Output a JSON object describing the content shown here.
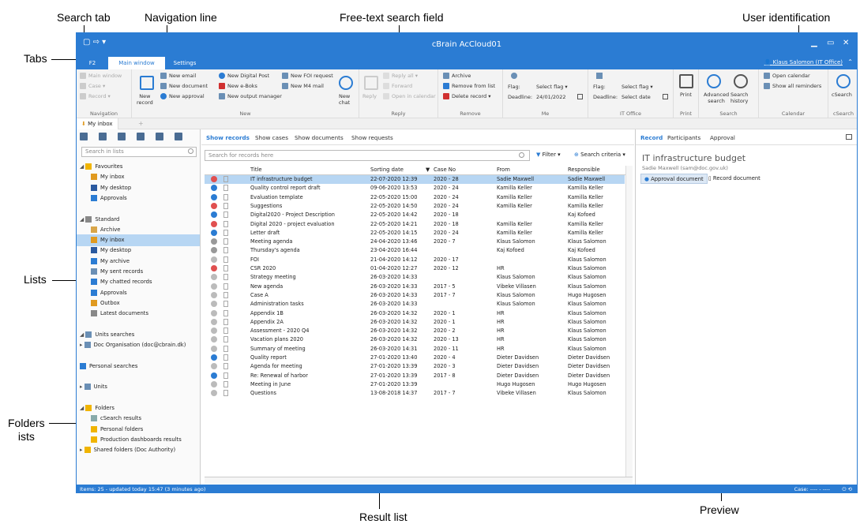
{
  "callouts": {
    "search_tab": "Search tab",
    "navigation_line": "Navigation line",
    "free_text": "Free-text search field",
    "user_id": "User identification",
    "tabs": "Tabs",
    "lists": "Lists",
    "folders": "Folders\nists",
    "result_list": "Result list",
    "preview": "Preview"
  },
  "app": {
    "title": "cBrain AcCloud01",
    "user": "Klaus Salomon (IT Office)"
  },
  "tabs": [
    "F2",
    "Main window",
    "Settings"
  ],
  "ribbon": {
    "nav": {
      "label": "Navigation",
      "items": [
        "Main window",
        "Case",
        "Record"
      ]
    },
    "new": {
      "label": "New",
      "big": "New\nrecord",
      "items": [
        "New email",
        "New document",
        "New approval",
        "New Digital Post",
        "New e-Boks",
        "New output manager",
        "New FOI request",
        "New M4 mail"
      ],
      "chat": "New\nchat"
    },
    "reply": {
      "label": "Reply",
      "big": "Reply",
      "items": [
        "Reply all",
        "Forward",
        "Open in calendar"
      ]
    },
    "remove": {
      "label": "Remove",
      "items": [
        "Archive",
        "Remove from list",
        "Delete record"
      ]
    },
    "me": {
      "label": "Me",
      "flag": "Flag:",
      "flagval": "Select flag",
      "deadline": "Deadline:",
      "deadlineval": "24/01/2022"
    },
    "itoffice": {
      "label": "IT Office",
      "flag": "Flag:",
      "flagval": "Select flag",
      "deadline": "Deadline:",
      "deadlineval": "Select date"
    },
    "print": {
      "label": "Print",
      "big": "Print"
    },
    "search": {
      "label": "Search",
      "adv": "Advanced\nsearch",
      "hist": "Search\nhistory"
    },
    "calendar": {
      "label": "Calendar",
      "items": [
        "Open calendar",
        "Show all reminders"
      ]
    },
    "csearch": {
      "label": "cSearch",
      "big": "cSearch"
    }
  },
  "page_tab": "My inbox",
  "left": {
    "search_placeholder": "Search in lists",
    "tree": [
      {
        "label": "Favourites",
        "indent": 0,
        "exp": "◢",
        "icon": "#f0b400"
      },
      {
        "label": "My inbox",
        "indent": 1,
        "icon": "#e09a20"
      },
      {
        "label": "My desktop",
        "indent": 1,
        "icon": "#2b5aa0"
      },
      {
        "label": "Approvals",
        "indent": 1,
        "icon": "#2b7cd3"
      },
      {
        "label": "",
        "indent": 0
      },
      {
        "label": "Standard",
        "indent": 0,
        "exp": "◢",
        "icon": "#888"
      },
      {
        "label": "Archive",
        "indent": 1,
        "icon": "#d9a64a"
      },
      {
        "label": "My inbox",
        "indent": 1,
        "icon": "#e09a20",
        "sel": true
      },
      {
        "label": "My desktop",
        "indent": 1,
        "icon": "#2b5aa0"
      },
      {
        "label": "My archive",
        "indent": 1,
        "icon": "#2b7cd3"
      },
      {
        "label": "My sent records",
        "indent": 1,
        "icon": "#6a8fb5"
      },
      {
        "label": "My chatted records",
        "indent": 1,
        "icon": "#2b7cd3"
      },
      {
        "label": "Approvals",
        "indent": 1,
        "icon": "#2b7cd3"
      },
      {
        "label": "Outbox",
        "indent": 1,
        "icon": "#e09a20"
      },
      {
        "label": "Latest documents",
        "indent": 1,
        "icon": "#888"
      },
      {
        "label": "",
        "indent": 0
      },
      {
        "label": "Units searches",
        "indent": 0,
        "exp": "◢",
        "icon": "#6a8fb5"
      },
      {
        "label": "Doc Organisation (doc@cbrain.dk)",
        "indent": 0,
        "exp": "▸",
        "icon": "#6a8fb5"
      },
      {
        "label": "",
        "indent": 0
      },
      {
        "label": "Personal searches",
        "indent": 0,
        "icon": "#2b7cd3"
      },
      {
        "label": "",
        "indent": 0
      },
      {
        "label": "Units",
        "indent": 0,
        "exp": "▸",
        "icon": "#6a8fb5"
      },
      {
        "label": "",
        "indent": 0
      },
      {
        "label": "Folders",
        "indent": 0,
        "exp": "◢",
        "icon": "#f0b400"
      },
      {
        "label": "cSearch results",
        "indent": 1,
        "icon": "#8aa"
      },
      {
        "label": "Personal folders",
        "indent": 1,
        "icon": "#f0b400"
      },
      {
        "label": "Production dashboards results",
        "indent": 1,
        "icon": "#f0b400"
      },
      {
        "label": "Shared folders (Doc Authority)",
        "indent": 0,
        "exp": "▸",
        "icon": "#f0b400"
      }
    ]
  },
  "middle": {
    "tabs": [
      "Show records",
      "Show cases",
      "Show documents",
      "Show requests"
    ],
    "search_placeholder": "Search for records here",
    "filter": "Filter",
    "criteria": "Search criteria",
    "columns": [
      "Title",
      "Sorting date",
      "Case No",
      "From",
      "Responsible"
    ],
    "rows": [
      {
        "t": "IT infrastructure budget",
        "d": "22-07-2020 12:39",
        "c": "2020 - 28",
        "f": "Sadie Maxwell",
        "r": "Sadie Maxwell",
        "i": "#e05050",
        "sel": true
      },
      {
        "t": "Quality control report draft",
        "d": "09-06-2020 13:53",
        "c": "2020 - 24",
        "f": "Kamilla Keller",
        "r": "Kamilla Keller",
        "i": "#2b7cd3"
      },
      {
        "t": "Evaluation template",
        "d": "22-05-2020 15:00",
        "c": "2020 - 24",
        "f": "Kamilla Keller",
        "r": "Kamilla Keller",
        "i": "#2b7cd3"
      },
      {
        "t": "Suggestions",
        "d": "22-05-2020 14:50",
        "c": "2020 - 24",
        "f": "Kamilla Keller",
        "r": "Kamilla Keller",
        "i": "#e05050"
      },
      {
        "t": "Digital2020 - Project Description",
        "d": "22-05-2020 14:42",
        "c": "2020 - 18",
        "f": "",
        "r": "Kaj Kofoed",
        "i": "#2b7cd3"
      },
      {
        "t": "Digital 2020 - project evaluation",
        "d": "22-05-2020 14:21",
        "c": "2020 - 18",
        "f": "Kamilla Keller",
        "r": "Kamilla Keller",
        "i": "#e05050"
      },
      {
        "t": "Letter draft",
        "d": "22-05-2020 14:15",
        "c": "2020 - 24",
        "f": "Kamilla Keller",
        "r": "Kamilla Keller",
        "i": "#2b7cd3"
      },
      {
        "t": "Meeting agenda",
        "d": "24-04-2020 13:46",
        "c": "2020 - 7",
        "f": "Klaus Salomon",
        "r": "Klaus Salomon",
        "i": "#999"
      },
      {
        "t": "Thursday's agenda",
        "d": "23-04-2020 16:44",
        "c": "",
        "f": "Kaj Kofoed",
        "r": "Kaj Kofoed",
        "i": "#999"
      },
      {
        "t": "FOI",
        "d": "21-04-2020 14:12",
        "c": "2020 - 17",
        "f": "",
        "r": "Klaus Salomon",
        "i": "#bbb"
      },
      {
        "t": "CSR 2020",
        "d": "01-04-2020 12:27",
        "c": "2020 - 12",
        "f": "HR",
        "r": "Klaus Salomon",
        "i": "#e05050"
      },
      {
        "t": "Strategy meeting",
        "d": "26-03-2020 14:33",
        "c": "",
        "f": "Klaus Salomon",
        "r": "Klaus Salomon",
        "i": "#bbb"
      },
      {
        "t": "New agenda",
        "d": "26-03-2020 14:33",
        "c": "2017 - 5",
        "f": "Vibeke Villasen",
        "r": "Klaus Salomon",
        "i": "#bbb"
      },
      {
        "t": "Case A",
        "d": "26-03-2020 14:33",
        "c": "2017 - 7",
        "f": "Klaus Salomon",
        "r": "Hugo Hugosen",
        "i": "#bbb"
      },
      {
        "t": "Administration tasks",
        "d": "26-03-2020 14:33",
        "c": "",
        "f": "Klaus Salomon",
        "r": "Klaus Salomon",
        "i": "#bbb"
      },
      {
        "t": "Appendix 1B",
        "d": "26-03-2020 14:32",
        "c": "2020 - 1",
        "f": "HR",
        "r": "Klaus Salomon",
        "i": "#bbb"
      },
      {
        "t": "Appendix 2A",
        "d": "26-03-2020 14:32",
        "c": "2020 - 1",
        "f": "HR",
        "r": "Klaus Salomon",
        "i": "#bbb"
      },
      {
        "t": "Assessment - 2020 Q4",
        "d": "26-03-2020 14:32",
        "c": "2020 - 2",
        "f": "HR",
        "r": "Klaus Salomon",
        "i": "#bbb"
      },
      {
        "t": "Vacation plans 2020",
        "d": "26-03-2020 14:32",
        "c": "2020 - 13",
        "f": "HR",
        "r": "Klaus Salomon",
        "i": "#bbb"
      },
      {
        "t": "Summary of meeting",
        "d": "26-03-2020 14:31",
        "c": "2020 - 11",
        "f": "HR",
        "r": "Klaus Salomon",
        "i": "#bbb"
      },
      {
        "t": "Quality report",
        "d": "27-01-2020 13:40",
        "c": "2020 - 4",
        "f": "Dieter Davidsen",
        "r": "Dieter Davidsen",
        "i": "#2b7cd3"
      },
      {
        "t": "Agenda for meeting",
        "d": "27-01-2020 13:39",
        "c": "2020 - 3",
        "f": "Dieter Davidsen",
        "r": "Dieter Davidsen",
        "i": "#bbb"
      },
      {
        "t": "Re: Renewal of harbor",
        "d": "27-01-2020 13:39",
        "c": "2017 - 8",
        "f": "Dieter Davidsen",
        "r": "Dieter Davidsen",
        "i": "#2b7cd3"
      },
      {
        "t": "Meeting in June",
        "d": "27-01-2020 13:39",
        "c": "",
        "f": "Hugo Hugosen",
        "r": "Hugo Hugosen",
        "i": "#bbb"
      },
      {
        "t": "Questions",
        "d": "13-08-2018 14:37",
        "c": "2017 - 7",
        "f": "Vibeke Villasen",
        "r": "Klaus Salomon",
        "i": "#bbb"
      }
    ]
  },
  "right": {
    "tabs": [
      "Record",
      "Participants",
      "Approval"
    ],
    "title": "IT infrastructure budget",
    "sub": "Sadie Maxwell (sam@doc.gov.uk)",
    "btn1": "Approval document",
    "btn2": "Record document"
  },
  "status": {
    "left": "Items: 25 - updated today 15:47 (3 minutes ago)",
    "right": "Case: ---- - ----"
  }
}
